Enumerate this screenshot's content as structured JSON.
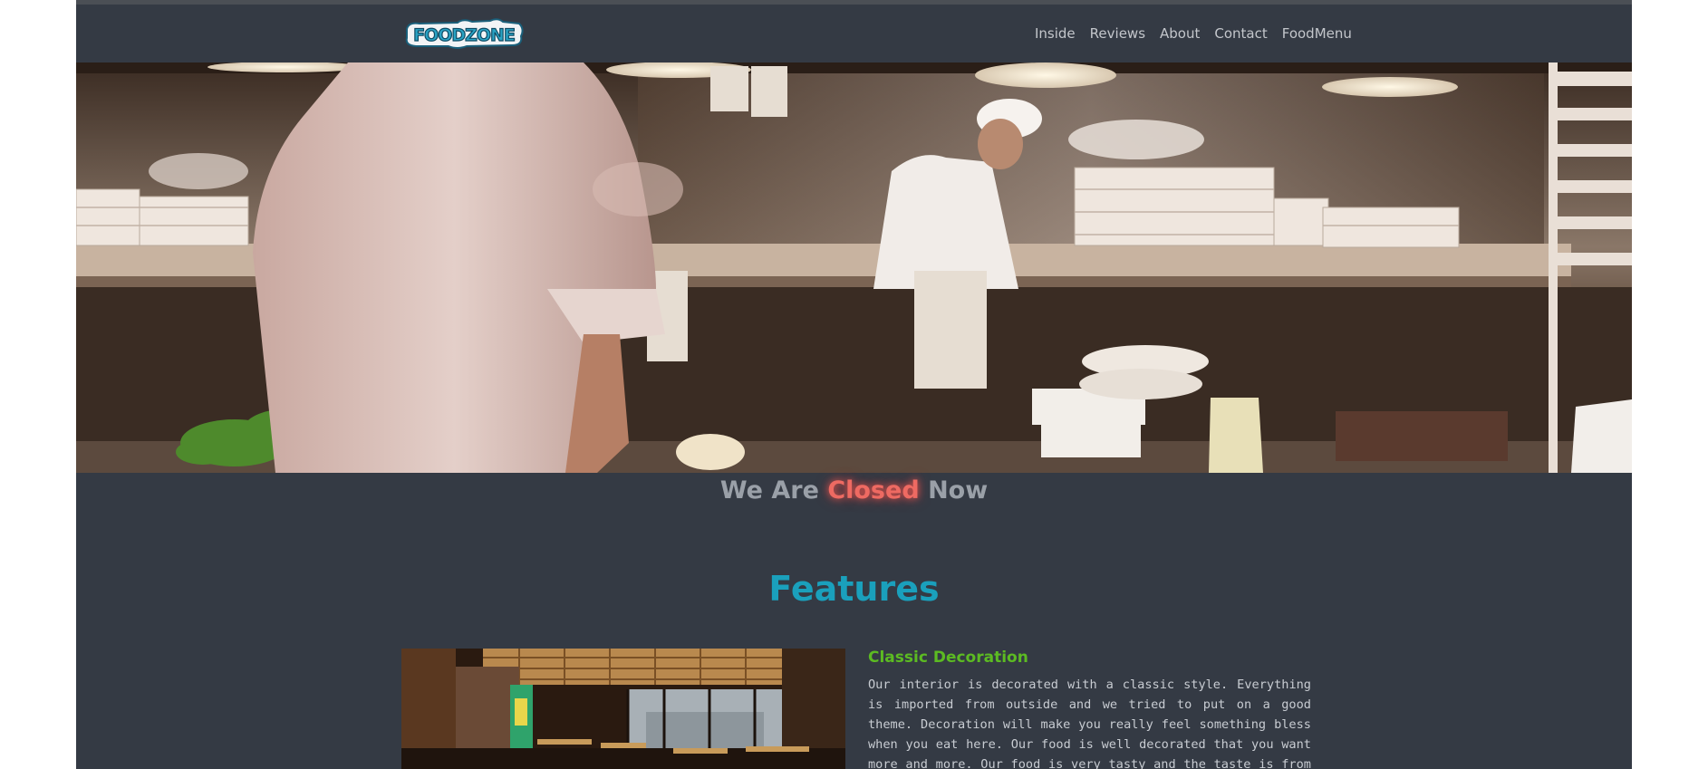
{
  "nav": {
    "logo_text": "FOODZONE",
    "links": [
      "Inside",
      "Reviews",
      "About",
      "Contact",
      "FoodMenu"
    ]
  },
  "hero": {
    "image": "restaurant-kitchen-chefs-photo"
  },
  "status": {
    "prefix": "We Are",
    "state": "Closed",
    "suffix": "Now"
  },
  "features": {
    "title": "Features",
    "items": [
      {
        "heading": "Classic Decoration",
        "image": "restaurant-dining-room-photo",
        "text": "Our interior is decorated with a classic style. Everything is imported from outside and we tried to put on a good theme. Decoration will make you really feel something bless when you eat here. Our food is well decorated that you want more and more. Our food is very tasty and the taste is from another level of amazing. All of your food ingredients is"
      }
    ]
  },
  "colors": {
    "page_bg": "#343a44",
    "nav_link": "#c3c6cb",
    "status_text": "#9aa0a8",
    "closed_accent": "#ee6a62",
    "features_title": "#1aa0bc",
    "feature_heading": "#5cbb22",
    "body_text": "#c8ccd2"
  }
}
